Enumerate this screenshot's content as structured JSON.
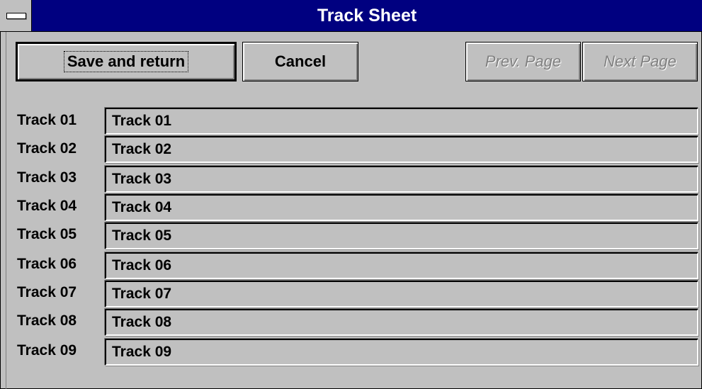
{
  "window": {
    "title": "Track Sheet"
  },
  "toolbar": {
    "save_label": "Save and return",
    "cancel_label": "Cancel",
    "prev_label": "Prev. Page",
    "next_label": "Next Page"
  },
  "tracks": [
    {
      "label": "Track 01",
      "value": "Track 01"
    },
    {
      "label": "Track 02",
      "value": "Track 02"
    },
    {
      "label": "Track 03",
      "value": "Track 03"
    },
    {
      "label": "Track 04",
      "value": "Track 04"
    },
    {
      "label": "Track 05",
      "value": "Track 05"
    },
    {
      "label": "Track 06",
      "value": "Track 06"
    },
    {
      "label": "Track 07",
      "value": "Track 07"
    },
    {
      "label": "Track 08",
      "value": "Track 08"
    },
    {
      "label": "Track 09",
      "value": "Track 09"
    }
  ],
  "colors": {
    "titlebar": "#000080",
    "face": "#c0c0c0",
    "disabled_text": "#808080"
  }
}
